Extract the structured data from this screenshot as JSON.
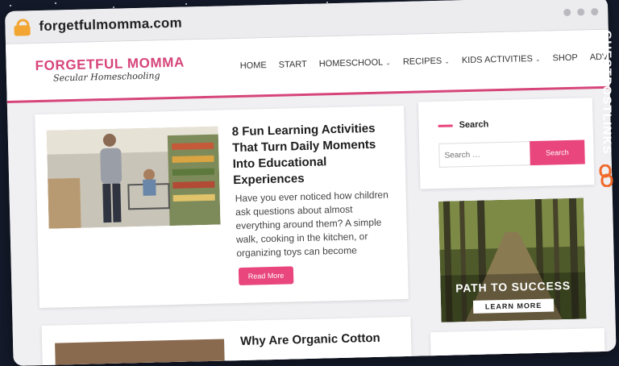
{
  "browser": {
    "url": "forgetfulmomma.com"
  },
  "site": {
    "logo_title": "FORGETFUL MOMMA",
    "logo_subtitle": "Secular Homeschooling",
    "nav": [
      {
        "label": "HOME"
      },
      {
        "label": "START"
      },
      {
        "label": "HOMESCHOOL",
        "dropdown": true
      },
      {
        "label": "RECIPES",
        "dropdown": true
      },
      {
        "label": "KIDS ACTIVITIES",
        "dropdown": true
      },
      {
        "label": "SHOP"
      },
      {
        "label": "ADVERTISE"
      }
    ],
    "accent_color": "#e8467c"
  },
  "main": {
    "post": {
      "title": "8 Fun Learning Activities That Turn Daily Moments Into Educational Experiences",
      "excerpt": "Have you ever noticed how children ask questions about almost everything around them?  A simple walk, cooking in the kitchen, or organizing toys can become",
      "read_more": "Read More"
    },
    "second_post": {
      "title": "Why Are Organic Cotton"
    }
  },
  "sidebar": {
    "search": {
      "title": "Search",
      "placeholder": "Search …",
      "button": "Search"
    },
    "ad": {
      "title": "PATH TO SUCCESS",
      "button": "LEARN MORE"
    }
  },
  "watermark": {
    "text": "GUESTPOSTLINKS"
  }
}
